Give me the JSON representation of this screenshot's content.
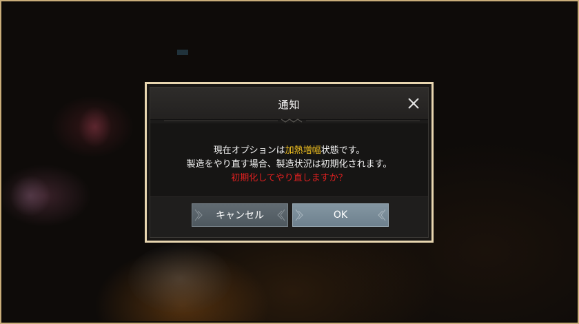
{
  "dialog": {
    "title": "通知",
    "close_icon": "close-icon",
    "message": {
      "line1_prefix": "現在オプションは",
      "line1_highlight": "加熱増幅",
      "line1_suffix": "状態です。",
      "line2": "製造をやり直す場合、製造状況は初期化されます。",
      "line3_warning": "初期化してやり直しますか？"
    },
    "buttons": {
      "cancel_label": "キャンセル",
      "ok_label": "OK"
    }
  },
  "colors": {
    "highlight": "#f0c020",
    "warning": "#e02020",
    "frame": "#c9ad7a",
    "dialog_border": "#e8d6b0"
  }
}
